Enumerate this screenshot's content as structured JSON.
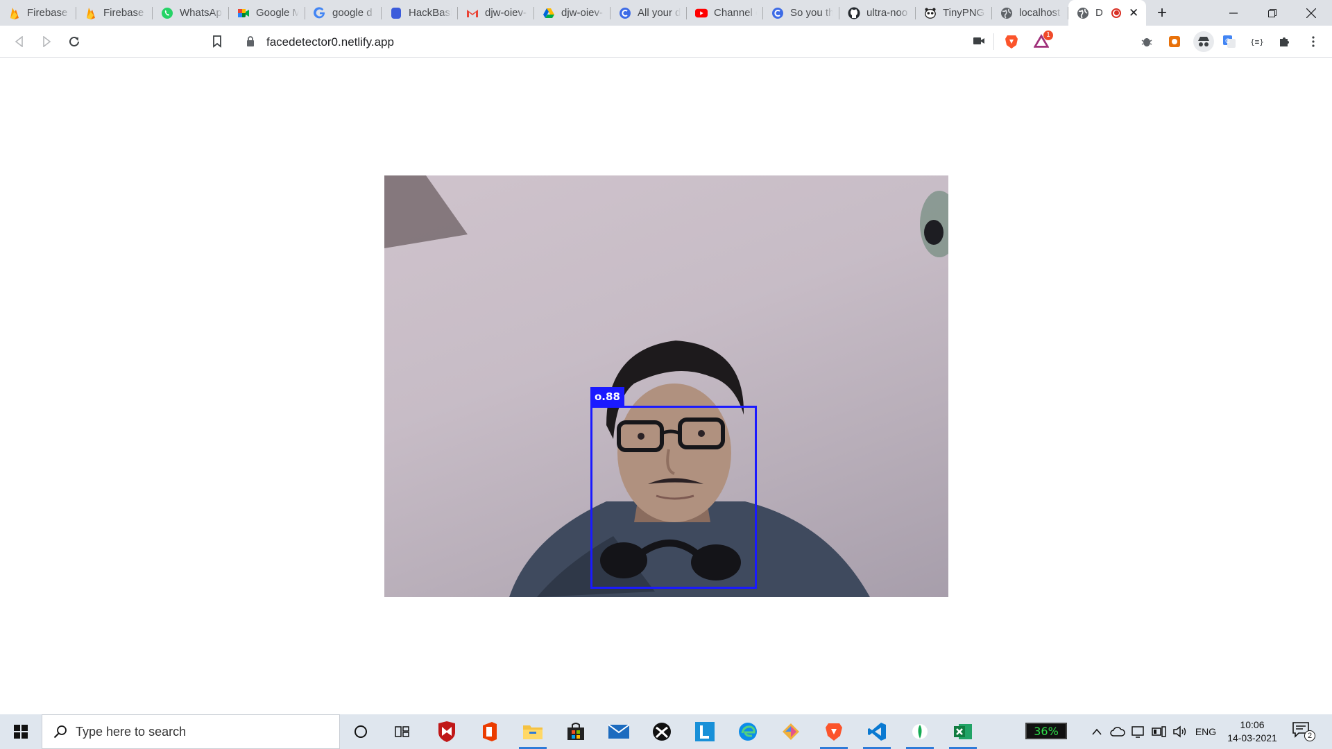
{
  "browser": {
    "tabs": [
      {
        "title": "Firebase",
        "icon": "firebase-icon"
      },
      {
        "title": "Firebase c",
        "icon": "firebase-icon"
      },
      {
        "title": "WhatsApp",
        "icon": "whatsapp-icon"
      },
      {
        "title": "Google M",
        "icon": "google-meet-icon"
      },
      {
        "title": "google d",
        "icon": "google-icon"
      },
      {
        "title": "HackBash",
        "icon": "hackbash-icon"
      },
      {
        "title": "djw-oiev-",
        "icon": "gmail-icon"
      },
      {
        "title": "djw-oiev-",
        "icon": "google-drive-icon"
      },
      {
        "title": "All your d",
        "icon": "c-logo-icon"
      },
      {
        "title": "Channel c",
        "icon": "youtube-icon"
      },
      {
        "title": "So you th",
        "icon": "c-logo-icon"
      },
      {
        "title": "ultra-noo",
        "icon": "github-icon"
      },
      {
        "title": "TinyPNG",
        "icon": "tinypng-icon"
      },
      {
        "title": "localhost",
        "icon": "globe-icon"
      }
    ],
    "active_tab": {
      "title": "D",
      "icon": "globe-icon",
      "recording": true
    },
    "url": "facedetector0.netlify.app",
    "brave_rewards_badge": "1"
  },
  "page": {
    "detection": {
      "score_label": "o.88",
      "box_color": "#1a1aff"
    }
  },
  "taskbar": {
    "search_placeholder": "Type here to search",
    "battery_label": "36%",
    "language": "ENG",
    "time": "10:06",
    "date": "14-03-2021",
    "notification_count": "2",
    "accent_color": "#2f7bd8"
  }
}
